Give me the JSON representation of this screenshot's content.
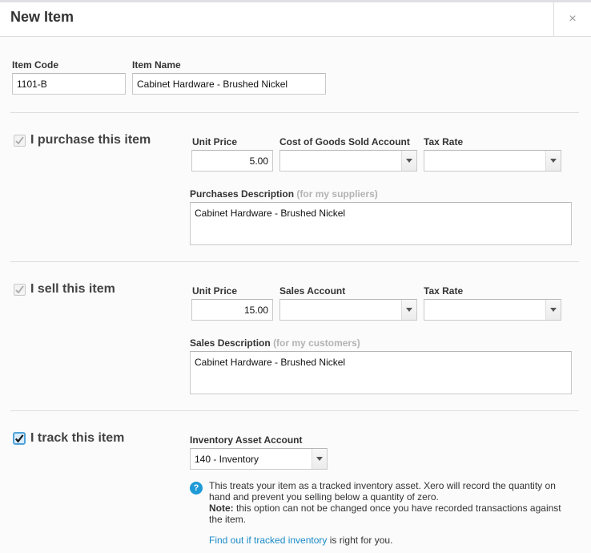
{
  "dialog": {
    "title": "New Item",
    "close_symbol": "×"
  },
  "item": {
    "code_label": "Item Code",
    "code_value": "1101-B",
    "name_label": "Item Name",
    "name_value": "Cabinet Hardware - Brushed Nickel"
  },
  "purchase": {
    "checkbox_label": "I purchase this item",
    "checked": true,
    "unit_price_label": "Unit Price",
    "unit_price_value": "5.00",
    "account_label": "Cost of Goods Sold Account",
    "account_value": "",
    "tax_label": "Tax Rate",
    "tax_value": "",
    "description_label": "Purchases Description",
    "description_hint": "(for my suppliers)",
    "description_value": "Cabinet Hardware - Brushed Nickel"
  },
  "sell": {
    "checkbox_label": "I sell this item",
    "checked": true,
    "unit_price_label": "Unit Price",
    "unit_price_value": "15.00",
    "account_label": "Sales Account",
    "account_value": "",
    "tax_label": "Tax Rate",
    "tax_value": "",
    "description_label": "Sales Description",
    "description_hint": "(for my customers)",
    "description_value": "Cabinet Hardware - Brushed Nickel"
  },
  "track": {
    "checkbox_label": "I track this item",
    "checked": true,
    "asset_account_label": "Inventory Asset Account",
    "asset_account_value": "140 - Inventory",
    "help_icon": "?",
    "help_text": "This treats your item as a tracked inventory asset. Xero will record the quantity on hand and prevent you selling below a quantity of zero.",
    "note_label": "Note:",
    "note_text": " this option can not be changed once you have recorded transactions against the item.",
    "link_text": "Find out if tracked inventory",
    "link_suffix": " is right for you."
  },
  "colors": {
    "link": "#1a8ac6",
    "help_icon": "#1e9ad6",
    "active_checkbox_border": "#4fa3d9"
  }
}
